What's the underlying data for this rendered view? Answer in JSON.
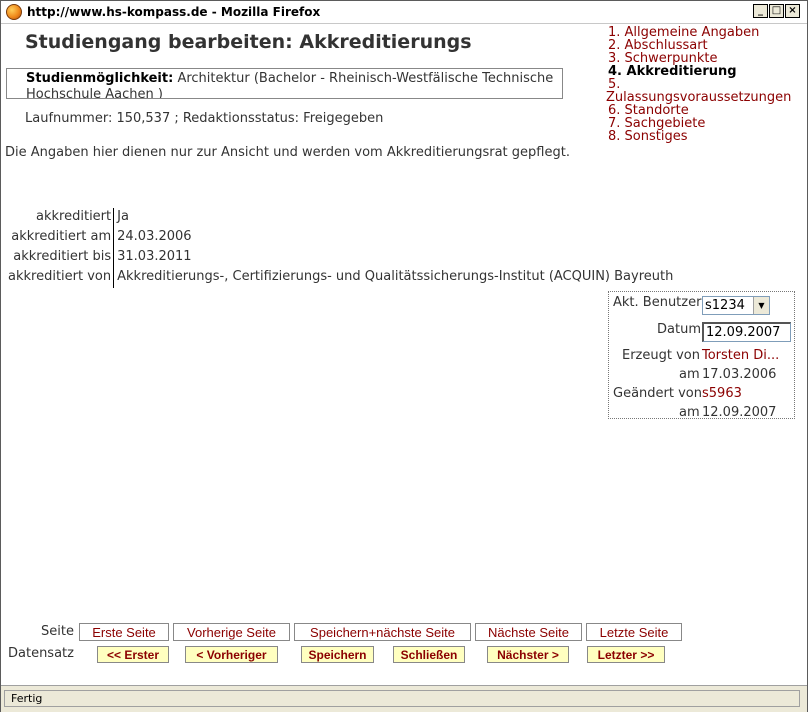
{
  "window": {
    "title": "http://www.hs-kompass.de - Mozilla Firefox"
  },
  "page": {
    "title": "Studiengang bearbeiten: Akkreditierungs",
    "studienmoeglichkeit_label": "Studienmöglichkeit:",
    "studienmoeglichkeit_value": "Architektur (Bachelor - Rheinisch-Westfälische Technische Hochschule Aachen )",
    "laufnummer": "Laufnummer: 150,537 ; Redaktionsstatus: Freigegeben",
    "hinweis": "Die Angaben hier dienen nur zur Ansicht und werden vom Akkreditierungsrat gepflegt."
  },
  "nav": [
    {
      "label": "1. Allgemeine Angaben"
    },
    {
      "label": "2. Abschlussart"
    },
    {
      "label": "3. Schwerpunkte"
    },
    {
      "label": "4. Akkreditierung"
    },
    {
      "label": "5."
    },
    {
      "label": "Zulassungsvoraussetzungen"
    },
    {
      "label": "6. Standorte"
    },
    {
      "label": "7. Sachgebiete"
    },
    {
      "label": "8. Sonstiges"
    }
  ],
  "akkreditierung": [
    {
      "label": "akkreditiert",
      "value": "Ja"
    },
    {
      "label": "akkreditiert am",
      "value": "24.03.2006"
    },
    {
      "label": "akkreditiert bis",
      "value": "31.03.2011"
    },
    {
      "label": "akkreditiert von",
      "value": "Akkreditierungs-, Certifizierungs- und Qualitätssicherungs-Institut (ACQUIN) Bayreuth"
    }
  ],
  "userbox": {
    "benutzer_label": "Akt. Benutzer",
    "benutzer_value": "s1234",
    "datum_label": "Datum",
    "datum_value": "12.09.2007",
    "erzeugt_label": "Erzeugt von",
    "erzeugt_von": "Torsten Di...",
    "erzeugt_am_label": "am",
    "erzeugt_am": "17.03.2006",
    "geaendert_label": "Geändert von",
    "geaendert_von": "s5963",
    "geaendert_am_label": "am",
    "geaendert_am": "12.09.2007"
  },
  "buttons": {
    "seite_label": "Seite",
    "datensatz_label": "Datensatz",
    "seite": [
      "Erste Seite",
      "Vorherige Seite",
      "Speichern+nächste Seite",
      "Nächste Seite",
      "Letzte Seite"
    ],
    "datensatz": [
      "<< Erster",
      "< Vorheriger",
      "Speichern",
      "Schließen",
      "Nächster >",
      "Letzter >>"
    ]
  },
  "status": {
    "text": "Fertig"
  }
}
